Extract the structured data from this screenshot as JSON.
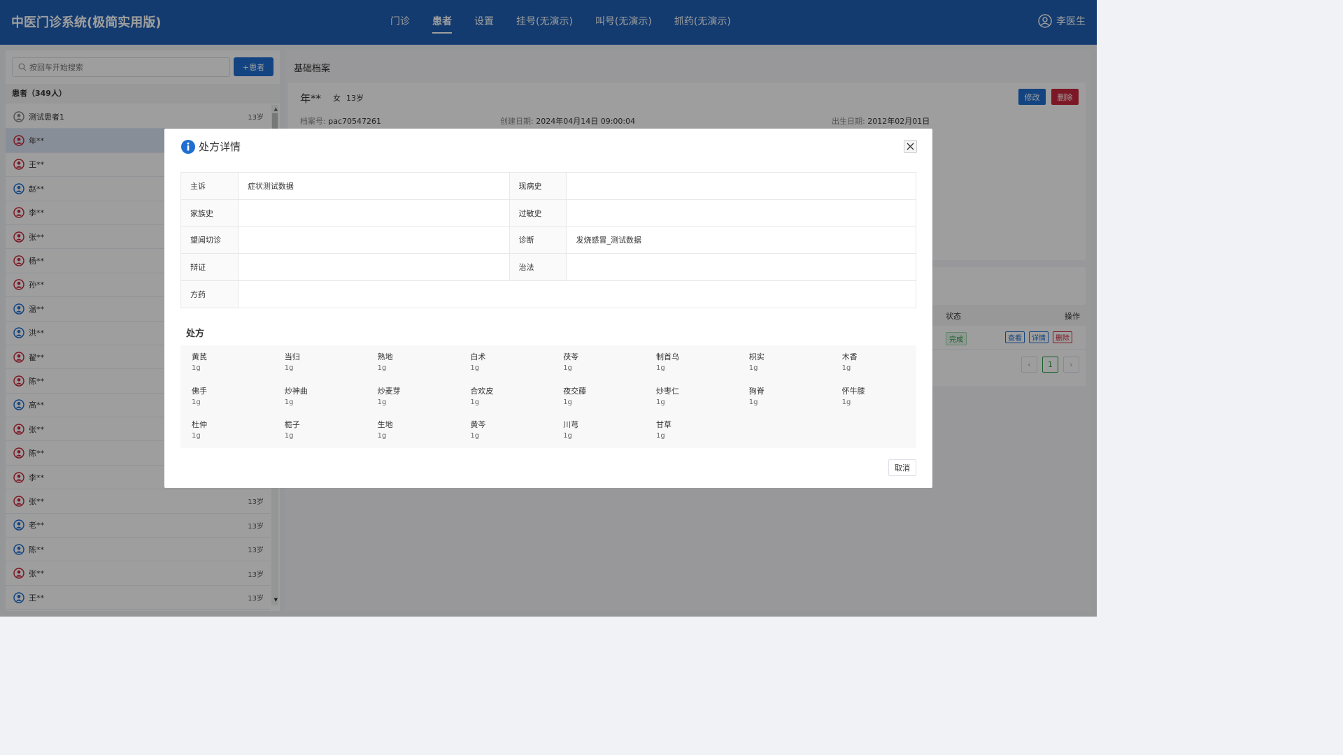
{
  "app_title": "中医门诊系统(极简实用版)",
  "nav": [
    "门诊",
    "患者",
    "设置",
    "挂号(无演示)",
    "叫号(无演示)",
    "抓药(无演示)"
  ],
  "nav_active": "患者",
  "user_name": "李医生",
  "left": {
    "search_placeholder": "按回车开始搜索",
    "add_button": "+患者",
    "count_label": "患者（349人）",
    "patients": [
      {
        "name": "测试患者1",
        "age": "13岁",
        "icon_color": "#888888"
      },
      {
        "name": "年**",
        "age": "",
        "icon_color": "#c8283c"
      },
      {
        "name": "王**",
        "age": "",
        "icon_color": "#c8283c"
      },
      {
        "name": "赵**",
        "age": "",
        "icon_color": "#1f6fd1"
      },
      {
        "name": "李**",
        "age": "",
        "icon_color": "#c8283c"
      },
      {
        "name": "张**",
        "age": "",
        "icon_color": "#c8283c"
      },
      {
        "name": "杨**",
        "age": "",
        "icon_color": "#c8283c"
      },
      {
        "name": "孙**",
        "age": "",
        "icon_color": "#c8283c"
      },
      {
        "name": "温**",
        "age": "",
        "icon_color": "#1f6fd1"
      },
      {
        "name": "洪**",
        "age": "",
        "icon_color": "#1f6fd1"
      },
      {
        "name": "翟**",
        "age": "",
        "icon_color": "#c8283c"
      },
      {
        "name": "陈**",
        "age": "",
        "icon_color": "#c8283c"
      },
      {
        "name": "高**",
        "age": "",
        "icon_color": "#1f6fd1"
      },
      {
        "name": "张**",
        "age": "",
        "icon_color": "#c8283c"
      },
      {
        "name": "陈**",
        "age": "",
        "icon_color": "#c8283c"
      },
      {
        "name": "李**",
        "age": "",
        "icon_color": "#c8283c"
      },
      {
        "name": "张**",
        "age": "13岁",
        "icon_color": "#c8283c"
      },
      {
        "name": "老**",
        "age": "13岁",
        "icon_color": "#1f6fd1"
      },
      {
        "name": "陈**",
        "age": "13岁",
        "icon_color": "#1f6fd1"
      },
      {
        "name": "张**",
        "age": "13岁",
        "icon_color": "#c8283c"
      },
      {
        "name": "王**",
        "age": "13岁",
        "icon_color": "#1f6fd1"
      }
    ],
    "selected_index": 1
  },
  "right": {
    "section_title": "基础档案",
    "name": "年**",
    "gender": "女",
    "age": "13岁",
    "edit_button": "修改",
    "delete_button": "删除",
    "file_no_label": "档案号:",
    "file_no": "pac70547261",
    "created_label": "创建日期:",
    "created": "2024年04月14日 09:00:04",
    "birth_label": "出生日期:",
    "birth": "2012年02月01日",
    "records": {
      "status_header": "状态",
      "ops_header": "操作",
      "status_tag": "完成",
      "view_button": "查看",
      "detail_button": "详情",
      "delete_button": "删除",
      "current_page": "1",
      "prev_glyph": "‹",
      "next_glyph": "›"
    }
  },
  "modal": {
    "title": "处方详情",
    "rows": [
      {
        "k1": "主诉",
        "v1": "症状测试数据",
        "k2": "现病史",
        "v2": ""
      },
      {
        "k1": "家族史",
        "v1": "",
        "k2": "过敏史",
        "v2": ""
      },
      {
        "k1": "望闻切诊",
        "v1": "",
        "k2": "诊断",
        "v2": "发烧感冒_测试数据"
      },
      {
        "k1": "辩证",
        "v1": "",
        "k2": "治法",
        "v2": ""
      }
    ],
    "prescription_label": "方药",
    "prescription_value": "",
    "rx_title": "处方",
    "herbs": [
      {
        "name": "黄芪",
        "dose": "1g"
      },
      {
        "name": "当归",
        "dose": "1g"
      },
      {
        "name": "熟地",
        "dose": "1g"
      },
      {
        "name": "白术",
        "dose": "1g"
      },
      {
        "name": "茯苓",
        "dose": "1g"
      },
      {
        "name": "制首乌",
        "dose": "1g"
      },
      {
        "name": "枳实",
        "dose": "1g"
      },
      {
        "name": "木香",
        "dose": "1g"
      },
      {
        "name": "佛手",
        "dose": "1g"
      },
      {
        "name": "炒神曲",
        "dose": "1g"
      },
      {
        "name": "炒麦芽",
        "dose": "1g"
      },
      {
        "name": "合欢皮",
        "dose": "1g"
      },
      {
        "name": "夜交藤",
        "dose": "1g"
      },
      {
        "name": "炒枣仁",
        "dose": "1g"
      },
      {
        "name": "狗脊",
        "dose": "1g"
      },
      {
        "name": "怀牛膝",
        "dose": "1g"
      },
      {
        "name": "杜仲",
        "dose": "1g"
      },
      {
        "name": "栀子",
        "dose": "1g"
      },
      {
        "name": "生地",
        "dose": "1g"
      },
      {
        "name": "黄芩",
        "dose": "1g"
      },
      {
        "name": "川芎",
        "dose": "1g"
      },
      {
        "name": "甘草",
        "dose": "1g"
      }
    ],
    "cancel_button": "取消"
  }
}
